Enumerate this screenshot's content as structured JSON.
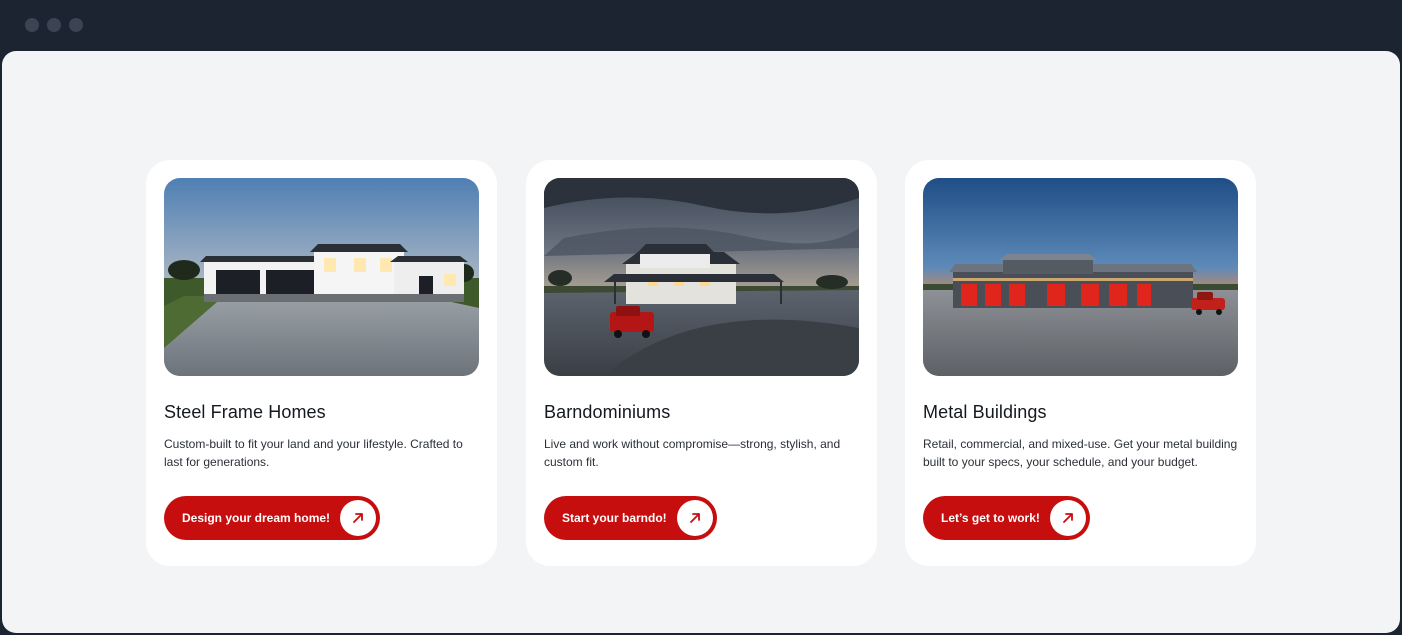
{
  "window": {
    "controls": [
      "close",
      "minimize",
      "maximize"
    ]
  },
  "cards": [
    {
      "title": "Steel Frame Homes",
      "description": "Custom-built to fit your land and your lifestyle. Crafted to last for generations.",
      "cta_label": "Design your dream home!",
      "image_subject": "white steel frame house with black garage doors and gravel driveway at dusk"
    },
    {
      "title": "Barndominiums",
      "description": "Live and work without compromise—strong, stylish, and custom fit.",
      "cta_label": "Start your barndo!",
      "image_subject": "white barndominium with porch lights and red pickup truck under cloudy sky"
    },
    {
      "title": "Metal Buildings",
      "description": "Retail, commercial, and mixed-use. Get your metal building built to your specs, your schedule, and your budget.",
      "cta_label": "Let’s get to work!",
      "image_subject": "gray metal building with red roll-up doors at sunset"
    }
  ],
  "colors": {
    "accent": "#c60e0e",
    "page_bg": "#f3f4f6",
    "card_bg": "#ffffff",
    "frame": "#1b2430"
  },
  "icons": {
    "cta": "arrow-up-right-icon"
  }
}
